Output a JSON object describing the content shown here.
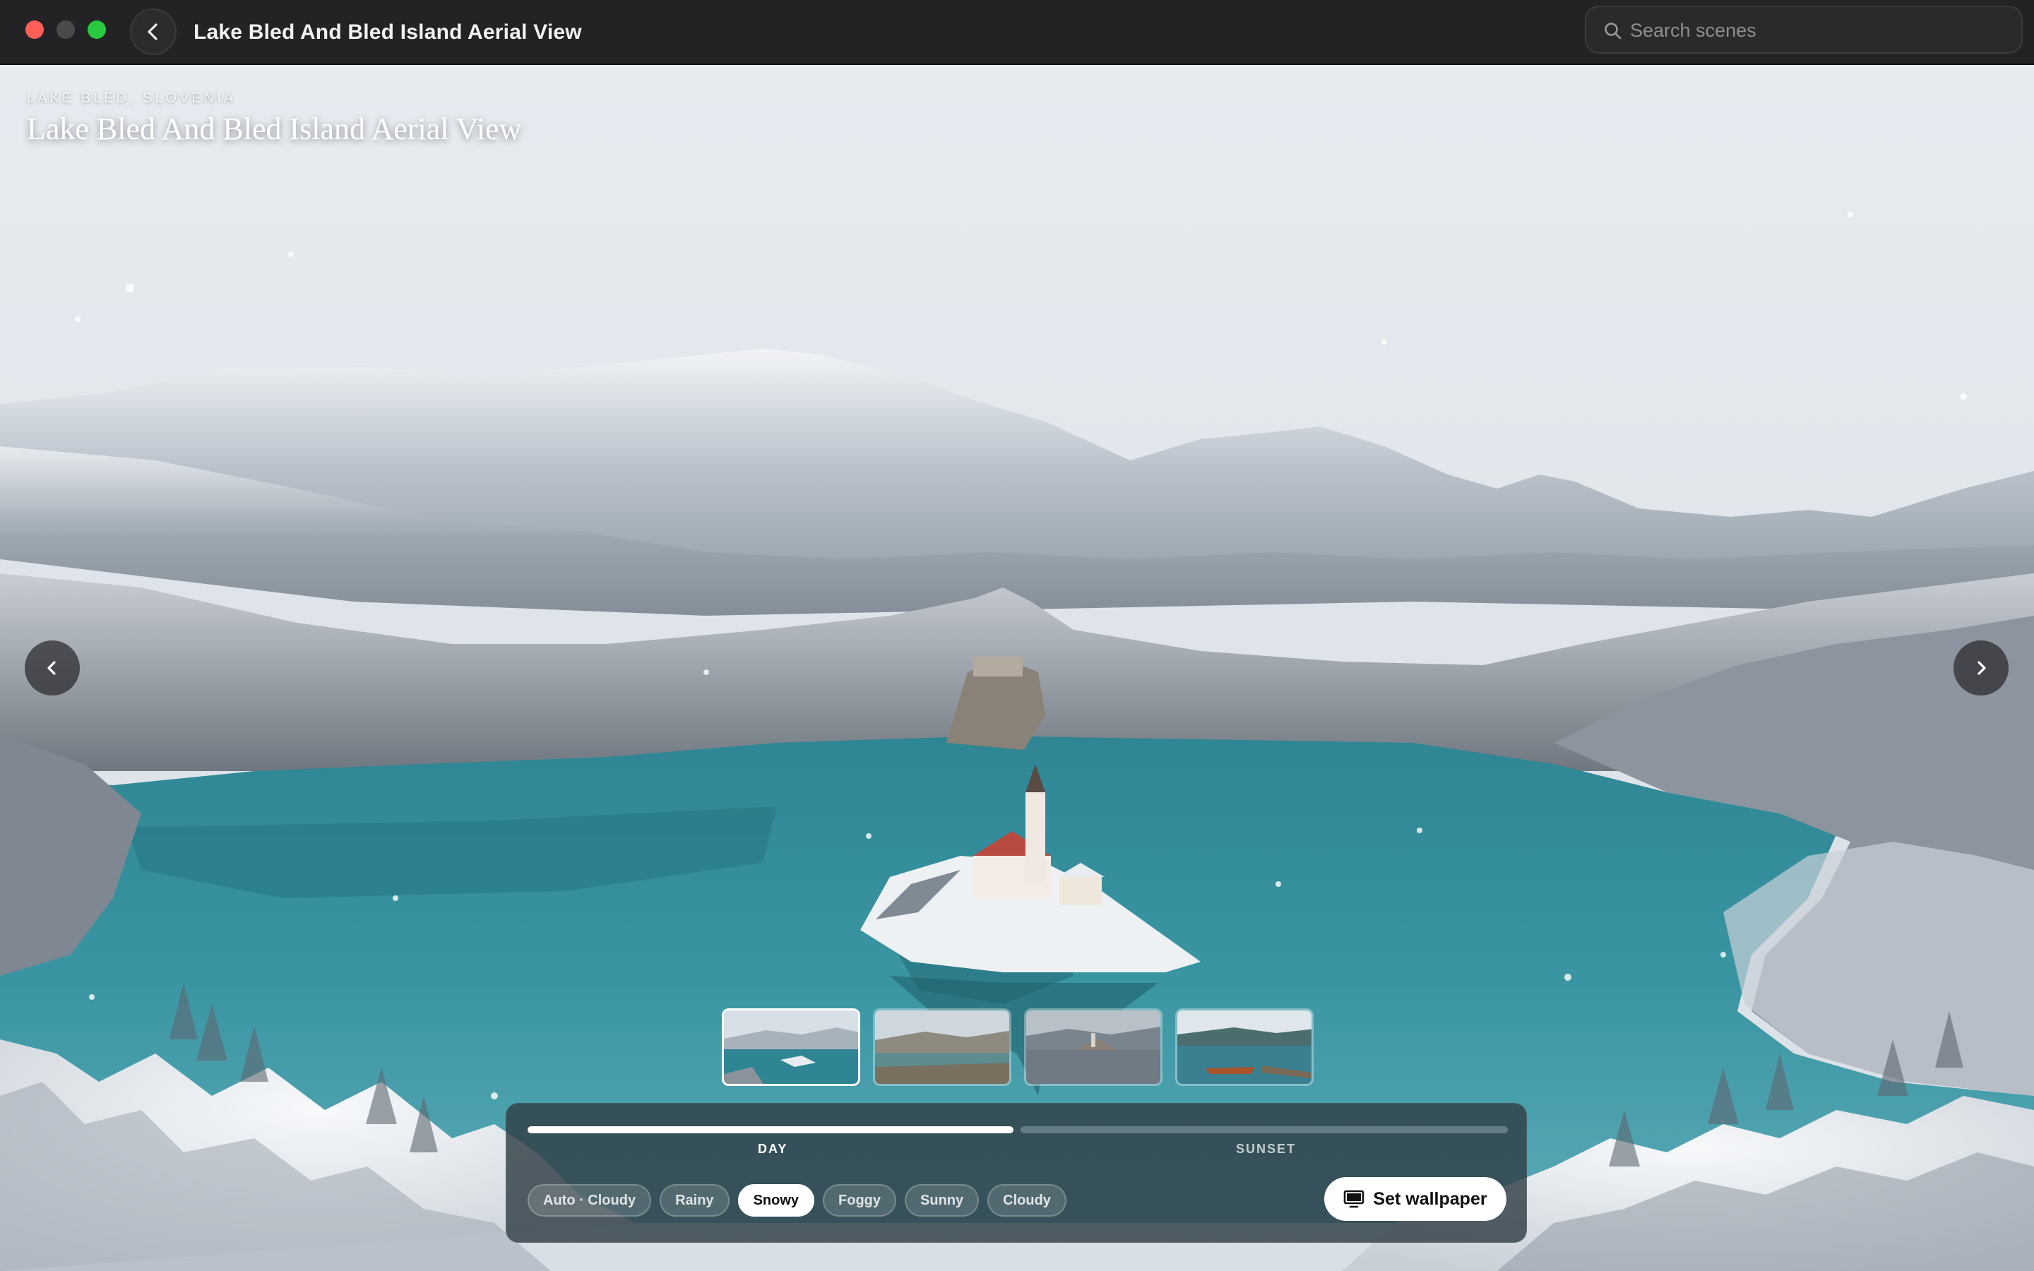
{
  "window": {
    "title": "Lake Bled And Bled Island Aerial View",
    "traffic_lights": [
      "close",
      "minimize",
      "maximize"
    ]
  },
  "search": {
    "placeholder": "Search scenes",
    "value": ""
  },
  "scene": {
    "location": "LAKE BLED, SLOVENIA",
    "title": "Lake Bled And Bled Island Aerial View"
  },
  "thumbnails": [
    {
      "selected": true
    },
    {
      "selected": false
    },
    {
      "selected": false
    },
    {
      "selected": false
    }
  ],
  "timeline": {
    "phases": [
      "DAY",
      "SUNSET"
    ],
    "active_phase": "DAY"
  },
  "weather": {
    "options": [
      "Auto · Cloudy",
      "Rainy",
      "Snowy",
      "Foggy",
      "Sunny",
      "Cloudy"
    ],
    "selected": "Snowy"
  },
  "actions": {
    "set_wallpaper": "Set wallpaper"
  },
  "icons": {
    "back": "chevron-left-icon",
    "search": "search-icon",
    "prev": "chevron-left-icon",
    "next": "chevron-right-icon",
    "wallpaper": "monitor-icon"
  },
  "colors": {
    "titlebar": "#232325",
    "lake": "#2f8593",
    "snow": "#eef1f4",
    "close": "#ff5f57",
    "maximize": "#28c840"
  }
}
